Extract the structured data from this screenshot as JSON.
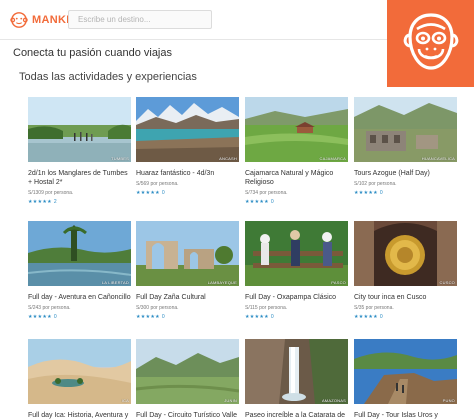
{
  "brand": {
    "name": "MANKI"
  },
  "search": {
    "placeholder": "Escribe un destino..."
  },
  "tagline": "Conecta tu pasión cuando viajas",
  "section_title": "Todas las actividades y experiencias",
  "colors": {
    "accent": "#f26b3a",
    "rating": "#2b8cc4"
  },
  "icons": {
    "brand": "monkey-face-icon",
    "star": "star-icon"
  },
  "cards": [
    {
      "title": "2d/1n los Manglares de Tumbes + Hostal 2*",
      "location": "TUMBES",
      "price": "S/1309 por persona.",
      "stars": "★★★★★",
      "reviews": "2"
    },
    {
      "title": "Huaraz fantástico - 4d/3n",
      "location": "ANCASH",
      "price": "S/569 por persona.",
      "stars": "★★★★★",
      "reviews": "0"
    },
    {
      "title": "Cajamarca Natural y Mágico Religioso",
      "location": "CAJAMARCA",
      "price": "S/734 por persona.",
      "stars": "★★★★★",
      "reviews": "0"
    },
    {
      "title": "Tours Azogue (Half Day)",
      "location": "HUANCAVELICA",
      "price": "S/102 por persona.",
      "stars": "★★★★★",
      "reviews": "0"
    },
    {
      "title": "Full day - Aventura en Cañoncillo",
      "location": "LA LIBERTAD",
      "price": "S/243 por persona.",
      "stars": "★★★★★",
      "reviews": "0"
    },
    {
      "title": "Full Day Zaña Cultural",
      "location": "LAMBAYEQUE",
      "price": "S/300 por persona.",
      "stars": "★★★★★",
      "reviews": "0"
    },
    {
      "title": "Full Day - Oxapampa Clásico",
      "location": "PASCO",
      "price": "S/115 por persona.",
      "stars": "★★★★★",
      "reviews": "0"
    },
    {
      "title": "City tour inca en Cusco",
      "location": "CUSCO",
      "price": "S/35 por persona.",
      "stars": "★★★★★",
      "reviews": "0"
    },
    {
      "title": "Full day Ica: Historia, Aventura y",
      "location": "ICA",
      "price": "",
      "stars": "",
      "reviews": ""
    },
    {
      "title": "Full Day - Circuito Turístico Valle del",
      "location": "JUNIN",
      "price": "",
      "stars": "",
      "reviews": ""
    },
    {
      "title": "Paseo increíble a la Catarata de",
      "location": "AMAZONAS",
      "price": "",
      "stars": "",
      "reviews": ""
    },
    {
      "title": "Full Day - Tour Islas Uros y Taquile -",
      "location": "PUNO",
      "price": "",
      "stars": "",
      "reviews": ""
    }
  ]
}
